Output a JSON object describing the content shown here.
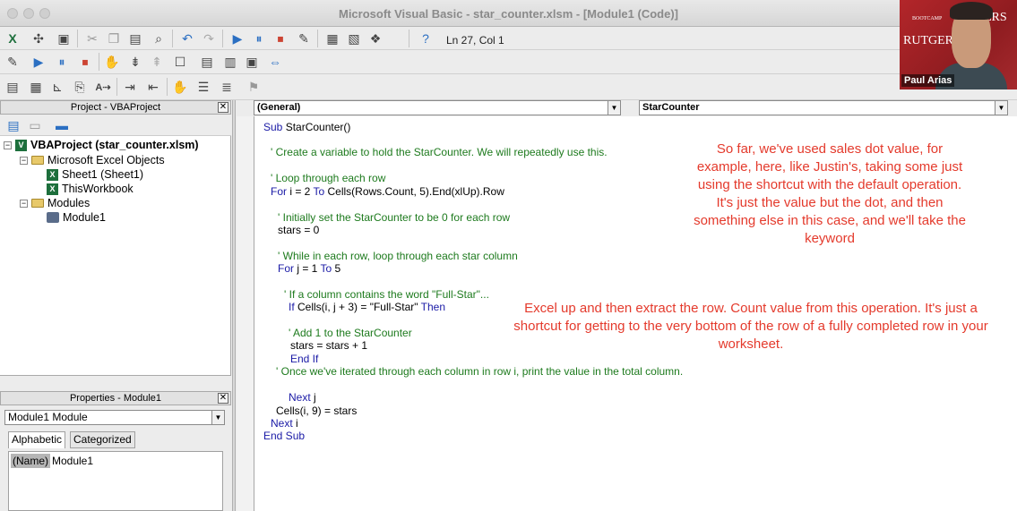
{
  "window": {
    "title": "Microsoft Visual Basic - star_counter.xlsm - [Module1 (Code)]"
  },
  "toolbar": {
    "position": "Ln 27, Col 1"
  },
  "project": {
    "header": "Project - VBAProject",
    "root": "VBAProject (star_counter.xlsm)",
    "excel_objects": "Microsoft Excel Objects",
    "sheet1": "Sheet1 (Sheet1)",
    "workbook": "ThisWorkbook",
    "modules": "Modules",
    "module1": "Module1"
  },
  "properties": {
    "header": "Properties - Module1",
    "object": "Module1 Module",
    "tab_alpha": "Alphabetic",
    "tab_cat": "Categorized",
    "name_key": "(Name)",
    "name_val": "Module1"
  },
  "code": {
    "object_combo": "(General)",
    "proc_combo": "StarCounter",
    "lines": [
      "Sub StarCounter()",
      "' Create a variable to hold the StarCounter. We will repeatedly use this.",
      "' Loop through each row",
      "For i = 2 To Cells(Rows.Count, 5).End(xlUp).Row",
      "' Initially set the StarCounter to be 0 for each row",
      "stars = 0",
      "' While in each row, loop through each star column",
      "For j = 1 To 5",
      "' If a column contains the word \"Full-Star\"...",
      "If Cells(i, j + 3) = \"Full-Star\" Then",
      "' Add 1 to the StarCounter",
      "stars = stars + 1",
      "End If",
      "' Once we've iterated through each column in row i, print the value in the total column.",
      "Next j",
      "Cells(i, 9) = stars",
      "Next i",
      "End Sub"
    ]
  },
  "captions": {
    "top": "So far, we've used sales dot value, for example, here, like Justin's, taking some just using the shortcut with the default operation. It's just the value but the dot, and then something else in this case, and we'll take the keyword",
    "bottom": "Excel up and then extract the row. Count value from this operation. It's just a shortcut for getting to the very bottom of the row of a fully completed row in your worksheet."
  },
  "webcam": {
    "name": "Paul Arias",
    "brand": "RUTGERS",
    "brand_small": "BOOTCAMP"
  }
}
